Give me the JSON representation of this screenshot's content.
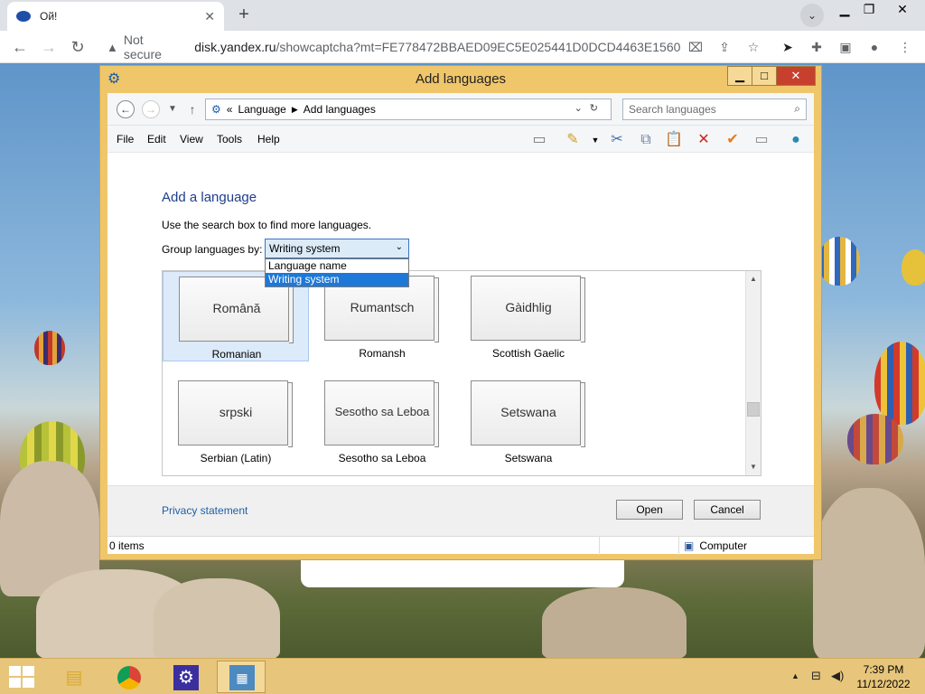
{
  "browser": {
    "tab_title": "Ой!",
    "tab_close": "✕",
    "new_tab": "+",
    "security_label": "Not secure",
    "url_host": "disk.yandex.ru",
    "url_path": "/showcaptcha?mt=FE778472BBAED09EC5E025441D0DCD4463E1560..."
  },
  "dialog": {
    "title": "Add languages",
    "breadcrumb": {
      "prefix": "«",
      "items": [
        "Language",
        "Add languages"
      ]
    },
    "search_placeholder": "Search languages",
    "menu": [
      "File",
      "Edit",
      "View",
      "Tools",
      "Help"
    ],
    "heading": "Add a language",
    "hint": "Use the search box to find more languages.",
    "group_label": "Group languages by:",
    "group_selected": "Writing system",
    "group_options": [
      "Language name",
      "Writing system"
    ],
    "languages": [
      {
        "native": "Română",
        "english": "Romanian"
      },
      {
        "native": "Rumantsch",
        "english": "Romansh"
      },
      {
        "native": "Gàidhlig",
        "english": "Scottish Gaelic"
      },
      {
        "native": "srpski",
        "english": "Serbian (Latin)"
      },
      {
        "native": "Sesotho sa Leboa",
        "english": "Sesotho sa Leboa"
      },
      {
        "native": "Setswana",
        "english": "Setswana"
      }
    ],
    "privacy": "Privacy statement",
    "open_button": "Open",
    "cancel_button": "Cancel",
    "status_items": "0 items",
    "status_computer": "Computer"
  },
  "taskbar": {
    "time": "7:39 PM",
    "date": "11/12/2022"
  }
}
